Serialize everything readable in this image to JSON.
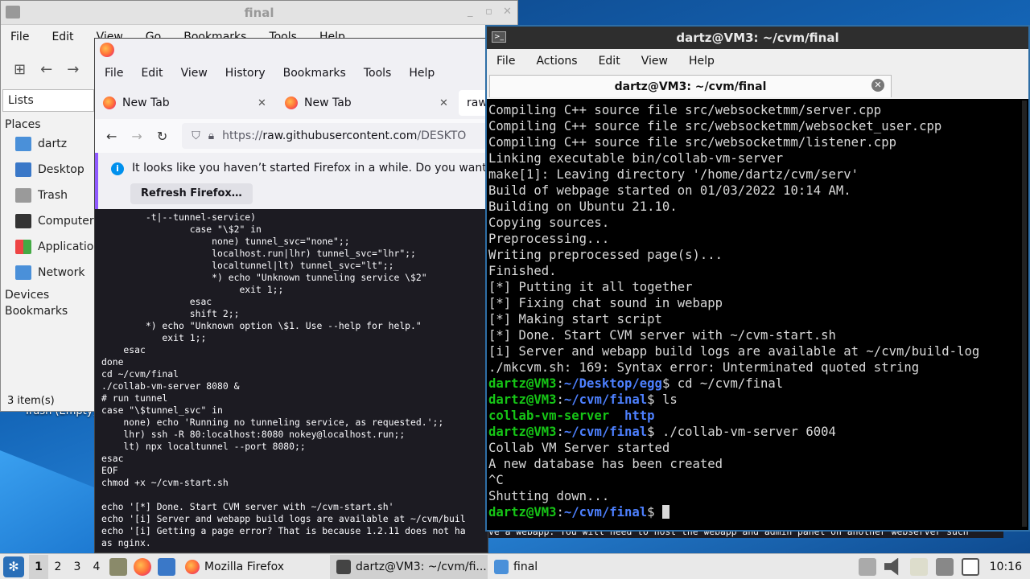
{
  "desktop": {
    "trash_label": "Trash (Empty)"
  },
  "file_manager": {
    "title": "final",
    "menu": [
      "File",
      "Edit",
      "View",
      "Go",
      "Bookmarks",
      "Tools",
      "Help"
    ],
    "sidebar": {
      "mode": "Lists",
      "places_header": "Places",
      "items": [
        {
          "label": "dartz",
          "icon": "home-folder-icon"
        },
        {
          "label": "Desktop",
          "icon": "desktop-icon"
        },
        {
          "label": "Trash",
          "icon": "trash-icon"
        },
        {
          "label": "Computer",
          "icon": "computer-icon"
        },
        {
          "label": "Applications",
          "icon": "applications-icon"
        },
        {
          "label": "Network",
          "icon": "network-folder-icon"
        }
      ],
      "devices_header": "Devices",
      "bookmarks_header": "Bookmarks"
    },
    "status": "3 item(s)"
  },
  "firefox": {
    "menu": [
      "File",
      "Edit",
      "View",
      "History",
      "Bookmarks",
      "Tools",
      "Help"
    ],
    "tabs": [
      {
        "label": "New Tab"
      },
      {
        "label": "New Tab"
      },
      {
        "label": "raw"
      }
    ],
    "url_prefix": "https://",
    "url_host": "raw.githubusercontent.com",
    "url_rest": "/DESKTO",
    "notice_text": "It looks like you haven’t started Firefox in a while. Do you want to",
    "notice_button": "Refresh Firefox…",
    "page_text": "        -t|--tunnel-service)\n                case \"\\$2\" in\n                    none) tunnel_svc=\"none\";;\n                    localhost.run|lhr) tunnel_svc=\"lhr\";;\n                    localtunnel|lt) tunnel_svc=\"lt\";;\n                    *) echo \"Unknown tunneling service \\$2\"\n                         exit 1;;\n                esac\n                shift 2;;\n        *) echo \"Unknown option \\$1. Use --help for help.\"\n           exit 1;;\n    esac\ndone\ncd ~/cvm/final\n./collab-vm-server 8080 &\n# run tunnel\ncase \"\\$tunnel_svc\" in\n    none) echo 'Running no tunneling service, as requested.';;\n    lhr) ssh -R 80:localhost:8080 nokey@localhost.run;;\n    lt) npx localtunnel --port 8080;;\nesac\nEOF\nchmod +x ~/cvm-start.sh\n\necho '[*] Done. Start CVM server with ~/cvm-start.sh'\necho '[i] Server and webapp build logs are available at ~/cvm/buil\necho '[i] Getting a page error? That is because 1.2.11 does not ha\nas nginx.",
    "overflow_text": "ve a webapp. You will need to host the webapp and admin panel on another webserver such"
  },
  "terminal": {
    "title": "dartz@VM3: ~/cvm/final",
    "menu": [
      "File",
      "Actions",
      "Edit",
      "View",
      "Help"
    ],
    "tab_label": "dartz@VM3: ~/cvm/final",
    "lines": [
      "Compiling C++ source file src/websocketmm/server.cpp",
      "Compiling C++ source file src/websocketmm/websocket_user.cpp",
      "Compiling C++ source file src/websocketmm/listener.cpp",
      "Linking executable bin/collab-vm-server",
      "make[1]: Leaving directory '/home/dartz/cvm/serv'",
      "Build of webpage started on 01/03/2022 10:14 AM.",
      "Building on Ubuntu 21.10.",
      "Copying sources.",
      "Preprocessing...",
      "Writing preprocessed page(s)...",
      "Finished.",
      "[*] Putting it all together",
      "[*] Fixing chat sound in webapp",
      "[*] Making start script",
      "[*] Done. Start CVM server with ~/cvm-start.sh",
      "[i] Server and webapp build logs are available at ~/cvm/build-log",
      "./mkcvm.sh: 169: Syntax error: Unterminated quoted string"
    ],
    "prompt_user": "dartz@VM3",
    "prompt_sep": ":",
    "session": [
      {
        "dir": "~/Desktop/egg",
        "cmd": " cd ~/cvm/final"
      },
      {
        "dir": "~/cvm/final",
        "cmd": " ls"
      }
    ],
    "ls_output": {
      "file1": "collab-vm-server",
      "file2": "http"
    },
    "run": {
      "dir": "~/cvm/final",
      "cmd": " ./collab-vm-server 6004"
    },
    "output": [
      "Collab VM Server started",
      "A new database has been created",
      "^C",
      "Shutting down..."
    ],
    "final_prompt": {
      "dir": "~/cvm/final",
      "cmd": " "
    }
  },
  "taskbar": {
    "workspaces": [
      "1",
      "2",
      "3",
      "4"
    ],
    "tasks": [
      {
        "label": "Mozilla Firefox",
        "icon": "firefox-icon"
      },
      {
        "label": "dartz@VM3: ~/cvm/fi...",
        "icon": "terminal-icon"
      },
      {
        "label": "final",
        "icon": "folder-icon"
      }
    ],
    "clock": "10:16"
  }
}
